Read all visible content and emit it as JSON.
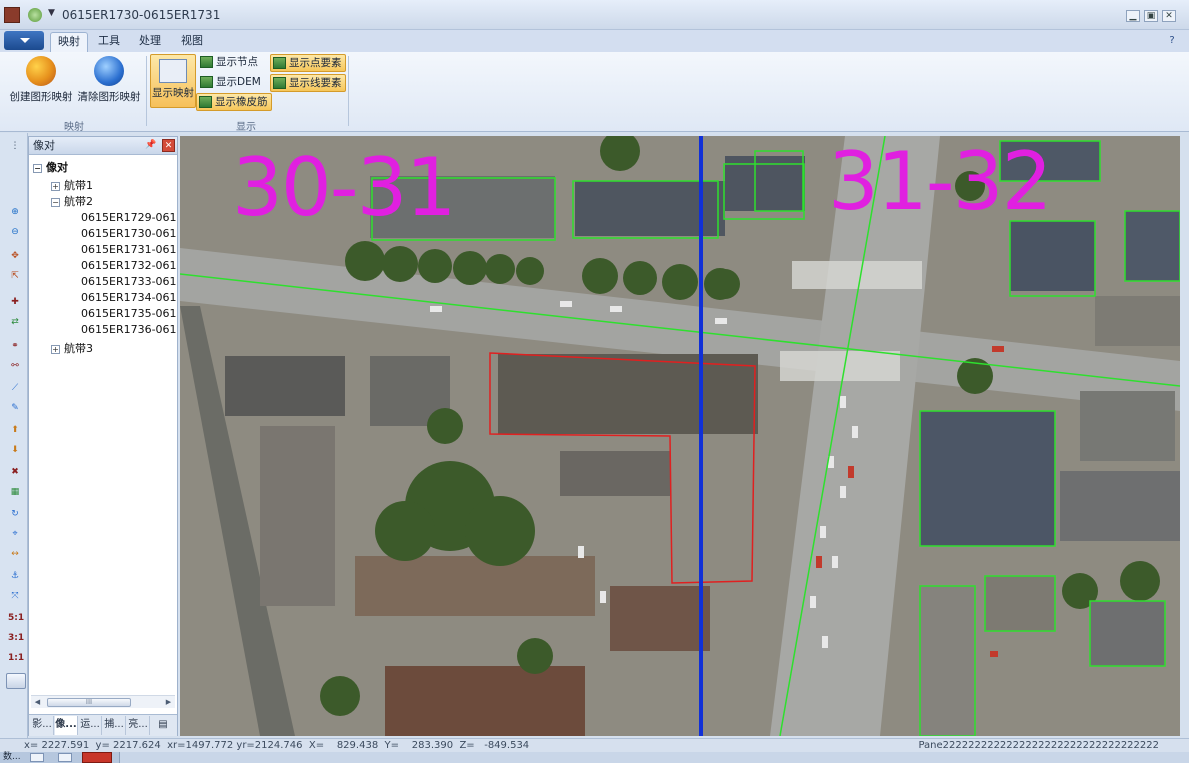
{
  "window": {
    "title": "0615ER1730-0615ER1731",
    "controls": [
      "minimize",
      "restore",
      "close"
    ]
  },
  "ribbon": {
    "tabs": [
      "映射",
      "工具",
      "处理",
      "视图"
    ],
    "active_tab": "映射",
    "groups": {
      "mapping": {
        "label": "映射",
        "create_label": "创建图形映射",
        "clear_label": "清除图形映射"
      },
      "display": {
        "label": "显示",
        "show_mapping_label": "显示映射",
        "show_nodes_label": "显示节点",
        "show_dem_label": "显示DEM",
        "show_rubber_label": "显示橡皮筋",
        "show_point_features_label": "显示点要素",
        "show_line_features_label": "显示线要素"
      }
    }
  },
  "left_toolbar": {
    "ratio_buttons": [
      "5:1",
      "3:1",
      "1:1"
    ]
  },
  "panel": {
    "title": "像对",
    "tree": {
      "root": "像对",
      "strips": [
        {
          "label": "航带1",
          "expanded": false,
          "children": []
        },
        {
          "label": "航带2",
          "expanded": true,
          "children": [
            "0615ER1729-061",
            "0615ER1730-061",
            "0615ER1731-061",
            "0615ER1732-061",
            "0615ER1733-061",
            "0615ER1734-061",
            "0615ER1735-061",
            "0615ER1736-061"
          ]
        },
        {
          "label": "航带3",
          "expanded": false,
          "children": []
        }
      ]
    },
    "scroll_thumb": "III",
    "tabs": [
      "影...",
      "像...",
      "运...",
      "捕...",
      "亮..."
    ],
    "active_tab_index": 1
  },
  "map": {
    "left_label": "30-31",
    "right_label": "31-32",
    "label_color": "#e020e0",
    "split_line_color": "#1030d8",
    "point_outline_color": "#2ee02e",
    "selected_outline_color": "#e02020"
  },
  "status": {
    "coords": "x= 2227.591  y= 2217.624  xr=1497.772 yr=2124.746  X=    829.438  Y=    283.390  Z=   -849.534",
    "pane": "Pane2222222222222222222222222222222222"
  },
  "taskbar": {
    "item_label": "数..."
  }
}
